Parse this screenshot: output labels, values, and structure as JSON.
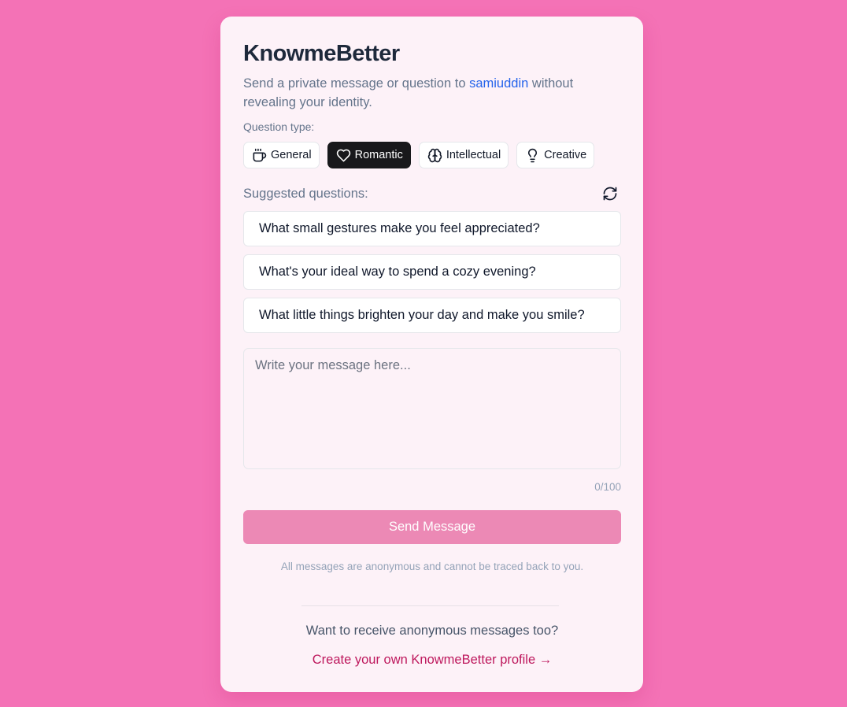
{
  "app": {
    "title": "KnowmeBetter"
  },
  "intro": {
    "prefix": "Send a private message or question to ",
    "username": "samiuddin",
    "suffix": " without revealing your identity."
  },
  "question_types": {
    "label": "Question type:",
    "active": "Romantic",
    "items": [
      {
        "label": "General",
        "icon": "coffee-icon"
      },
      {
        "label": "Romantic",
        "icon": "heart-icon"
      },
      {
        "label": "Intellectual",
        "icon": "brain-icon"
      },
      {
        "label": "Creative",
        "icon": "lightbulb-icon"
      }
    ]
  },
  "suggestions": {
    "label": "Suggested questions:",
    "refresh_icon": "refresh-icon",
    "items": [
      "What small gestures make you feel appreciated?",
      "What's your ideal way to spend a cozy evening?",
      "What little things brighten your day and make you smile?"
    ]
  },
  "message": {
    "placeholder": "Write your message here...",
    "value": "",
    "counter": "0/100"
  },
  "send_button": "Send Message",
  "anonymity_note": "All messages are anonymous and cannot be traced back to you.",
  "footer": {
    "prompt": "Want to receive anonymous messages too?",
    "link": "Create your own KnowmeBetter profile →"
  },
  "colors": {
    "background": "#f472b6",
    "card": "#fdf2f8",
    "accent_link": "#be185d",
    "username": "#2563eb",
    "send_button": "#ec89b5",
    "active_type": "#18181b"
  }
}
